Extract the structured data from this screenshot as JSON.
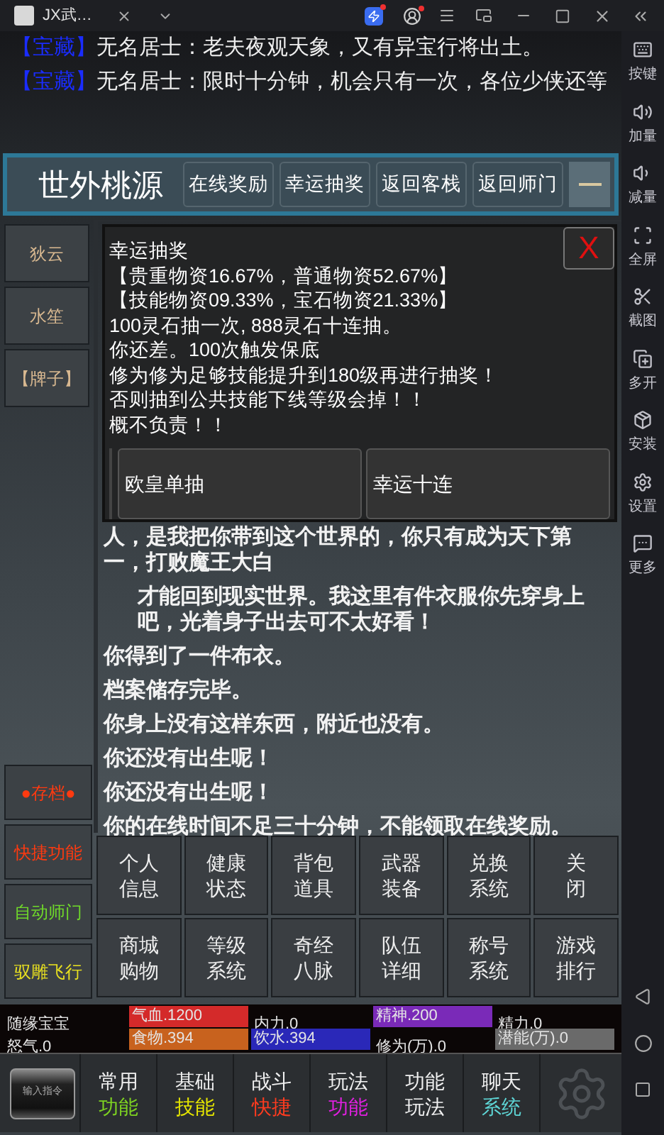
{
  "title_bar": {
    "tab_title": "JX武…"
  },
  "chat": [
    {
      "tag": "【宝藏】",
      "text": "无名居士：老夫夜观天象，又有异宝行将出土。"
    },
    {
      "tag": "【宝藏】",
      "text": "无名居士：限时十分钟，机会只有一次，各位少侠还等"
    }
  ],
  "location": {
    "title": "世外桃源",
    "buttons": [
      "在线奖励",
      "幸运抽奖",
      "返回客栈",
      "返回师门"
    ]
  },
  "npcs": [
    "狄云",
    "水笙",
    "【牌子】"
  ],
  "lottery": {
    "title": "幸运抽奖",
    "close": "X",
    "lines": [
      "【贵重物资16.67%，普通物资52.67%】",
      "【技能物资09.33%，宝石物资21.33%】",
      "100灵石抽一次, 888灵石十连抽。",
      "你还差。100次触发保底",
      "修为修为足够技能提升到180级再进行抽奖！",
      "否则抽到公共技能下线等级会掉！！",
      "概不负责！！"
    ],
    "buttons": [
      "欧皇单抽",
      "幸运十连"
    ]
  },
  "log": [
    {
      "text": "人，是我把你带到这个世界的，你只有成为天下第一，打败魔王大白",
      "indent": false
    },
    {
      "text": "才能回到现实世界。我这里有件衣服你先穿身上吧，光着身子出去可不太好看！",
      "indent": true
    },
    {
      "text": "你得到了一件布衣。",
      "indent": false
    },
    {
      "text": "档案储存完毕。",
      "indent": false
    },
    {
      "text": "你身上没有这样东西，附近也没有。",
      "indent": false
    },
    {
      "text": "你还没有出生呢！",
      "indent": false
    },
    {
      "text": "你还没有出生呢！",
      "indent": false
    },
    {
      "text": "你的在线时间不足三十分钟，不能领取在线奖励。",
      "indent": false
    }
  ],
  "quick_buttons": [
    {
      "label": "●存档●",
      "color": "#ff3a10"
    },
    {
      "label": "快捷功能",
      "color": "#ff3a10"
    },
    {
      "label": "自动师门",
      "color": "#6fd92a"
    },
    {
      "label": "驭雕飞行",
      "color": "#e8e020"
    }
  ],
  "menu_grid": [
    [
      "个人",
      "信息"
    ],
    [
      "健康",
      "状态"
    ],
    [
      "背包",
      "道具"
    ],
    [
      "武器",
      "装备"
    ],
    [
      "兑换",
      "系统"
    ],
    [
      "关",
      "闭"
    ],
    [
      "商城",
      "购物"
    ],
    [
      "等级",
      "系统"
    ],
    [
      "奇经",
      "八脉"
    ],
    [
      "队伍",
      "详细"
    ],
    [
      "称号",
      "系统"
    ],
    [
      "游戏",
      "排行"
    ]
  ],
  "stats": [
    [
      {
        "label": "随缘宝宝"
      },
      {
        "label": "气血.1200",
        "color": "#d42a2a"
      },
      {
        "label": "内力.0"
      },
      {
        "label": "精神.200",
        "color": "#7a2ab8"
      },
      {
        "label": "精力.0"
      }
    ],
    [
      {
        "label": "怒气.0"
      },
      {
        "label": "食物.394",
        "color": "#c8621e"
      },
      {
        "label": "饮水.394",
        "color": "#2a28b8"
      },
      {
        "label": "修为(万).0"
      },
      {
        "label": "潜能(万).0",
        "color": "#6a6a6a"
      }
    ]
  ],
  "bottom_nav": {
    "input_button": "输入指令",
    "tabs": [
      {
        "top": "常用",
        "bottom": "功能",
        "color": "#7ed321"
      },
      {
        "top": "基础",
        "bottom": "技能",
        "color": "#e6e600"
      },
      {
        "top": "战斗",
        "bottom": "快捷",
        "color": "#ff3b1f"
      },
      {
        "top": "玩法",
        "bottom": "功能",
        "color": "#e020e0"
      },
      {
        "top": "功能",
        "bottom": "玩法",
        "color": "#f0f0f0"
      },
      {
        "top": "聊天",
        "bottom": "系统",
        "color": "#5ed6d6"
      }
    ]
  },
  "side_toolbar": [
    "按键",
    "加量",
    "减量",
    "全屏",
    "截图",
    "多开",
    "安装",
    "设置",
    "更多"
  ]
}
